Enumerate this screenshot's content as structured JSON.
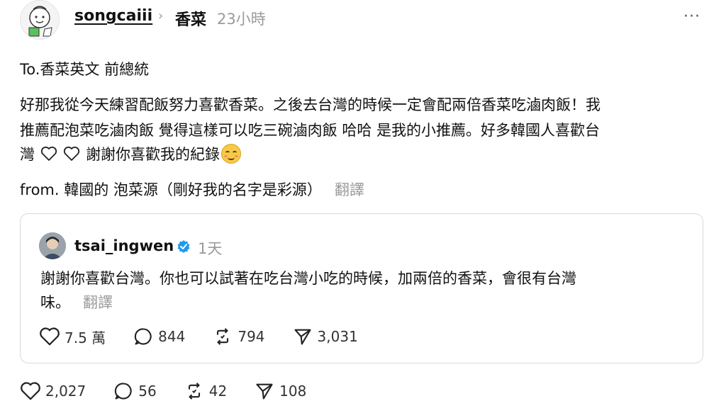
{
  "post": {
    "username": "songcaiii",
    "topic": "香菜",
    "timestamp": "23小時",
    "more": "···",
    "line1": "To.香菜英文 前總統",
    "line2": "好那我從今天練習配飯努力喜歡香菜。之後去台灣的時候一定會配兩倍香菜吃滷肉飯！我",
    "line3": "推薦配泡菜吃滷肉飯 覺得這樣可以吃三碗滷肉飯 哈哈 是我的小推薦。好多韓國人喜歡台",
    "line4_a": "灣",
    "line4_b": "謝謝你喜歡我的紀錄",
    "line5": "from. 韓國的 泡菜源（剛好我的名字是彩源）",
    "translate": "翻譯",
    "stats": {
      "likes": "2,027",
      "replies": "56",
      "reposts": "42",
      "shares": "108"
    }
  },
  "quote": {
    "username": "tsai_ingwen",
    "timestamp": "1天",
    "line1": "謝謝你喜歡台灣。你也可以試著在吃台灣小吃的時候，加兩倍的香菜，會很有台灣",
    "line2": "味。",
    "translate": "翻譯",
    "stats": {
      "likes": "7.5 萬",
      "replies": "844",
      "reposts": "794",
      "shares": "3,031"
    }
  },
  "icons": {
    "like": "heart-outline-icon",
    "reply": "comment-bubble-icon",
    "repost": "repost-arrows-icon",
    "share": "send-paper-plane-icon",
    "verified": "verified-badge-icon",
    "more": "more-dots-icon"
  },
  "colors": {
    "text": "#111111",
    "muted": "#9a9a9a",
    "border": "#d9d9d9",
    "verified": "#1d9bf0"
  }
}
